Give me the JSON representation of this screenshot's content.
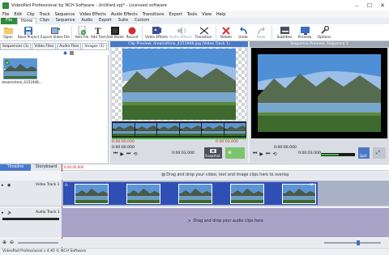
{
  "window": {
    "title": "VideoPad Professional by NCH Software - Untitled.vpj* - Licensed software",
    "min": "–",
    "max": "☐",
    "close": "✕"
  },
  "menu": [
    "File",
    "Edit",
    "Clip",
    "Track",
    "Sequence",
    "Video Effects",
    "Audio Effects",
    "Transitions",
    "Export",
    "Tools",
    "View",
    "Help"
  ],
  "ribbon_tabs": [
    "File",
    "Home",
    "Clips",
    "Sequence",
    "Audio",
    "Export",
    "Suite",
    "Custom"
  ],
  "ribbon_active": "Home",
  "toolbar": {
    "open": "Open",
    "save_project": "Save Project",
    "export_video": "Export Video File",
    "add_file": "Add File",
    "add_text": "Add Text",
    "add_blank": "Add Blank",
    "record": "Record",
    "video_effects": "Video Effects",
    "audio_effects": "Audio Effects",
    "transition": "Transition",
    "delete": "Delete",
    "undo": "Undo",
    "redo": "Redo",
    "subtitles": "Subtitles",
    "preview": "Preview",
    "options": "Options"
  },
  "bin": {
    "tabs": [
      "Sequences (1)",
      "Video Files",
      "Audio Files",
      "Images (1)"
    ],
    "clip_name": "dreamstime_4151946..."
  },
  "clip_preview": {
    "title": "Clip Preview: dreamstime_4151946.jpg (Video Track 1)",
    "time_start": "0:00:00.000",
    "time_mid": "0:00:03.000",
    "time_end": "0:00:03.000",
    "snapshot": "Snapshot"
  },
  "seq_preview": {
    "title": "Sequence Preview: Sequence 1",
    "time_start": "0:00:00.000",
    "time_end": "0:00:03.000",
    "split": "Split"
  },
  "timeline": {
    "tab_timeline": "Timeline",
    "tab_storyboard": "Storyboard",
    "ruler_start": "0:00:00.000",
    "video_drop": "Drag and drop your video, text and image clips here to overlay",
    "video_track": "Video Track 1",
    "audio_track": "Audio Track 1",
    "audio_drop": "Drag and drop your audio clips here"
  },
  "status": "VideoPad Professional v 4.40 © NCH Software",
  "colors": {
    "accent": "#4a79c7",
    "file_tab": "#2e8b40",
    "video_clip": "#2f4fb4",
    "audio_track": "#a9a3c8"
  }
}
